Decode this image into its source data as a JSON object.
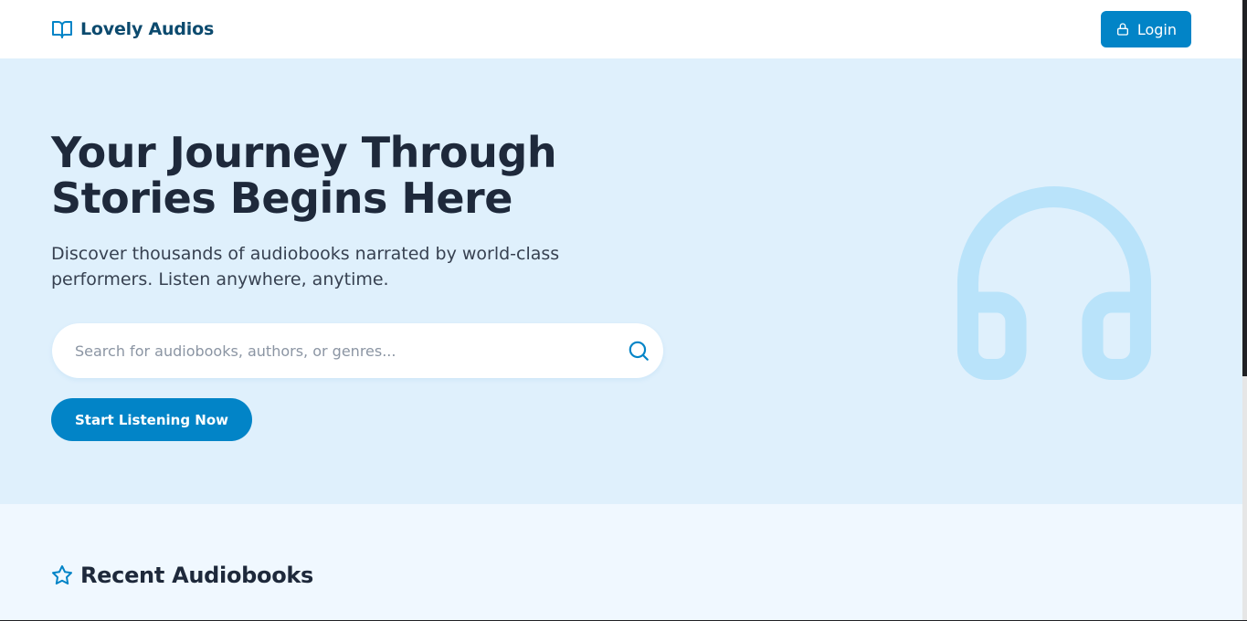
{
  "header": {
    "brand_name": "Lovely Audios",
    "brand_icon": "book-open-icon",
    "login_label": "Login",
    "login_icon": "lock-icon"
  },
  "hero": {
    "title_line1": "Your Journey Through",
    "title_line2": "Stories Begins Here",
    "subtitle_line1": "Discover thousands of audiobooks narrated by world-class",
    "subtitle_line2": "performers. Listen anywhere, anytime.",
    "search_placeholder": "Search for audiobooks, authors, or genres...",
    "search_value": "",
    "search_icon": "search-icon",
    "cta_label": "Start Listening Now",
    "illustration": "headphones-icon"
  },
  "section": {
    "title": "Recent Audiobooks",
    "icon": "star-icon"
  },
  "colors": {
    "brand": "#0c4a6e",
    "accent": "#0284c7",
    "hero_bg": "#dff0fc",
    "page_bg": "#f0f8ff",
    "illustration": "#b9e3fa",
    "heading": "#1e293b"
  }
}
